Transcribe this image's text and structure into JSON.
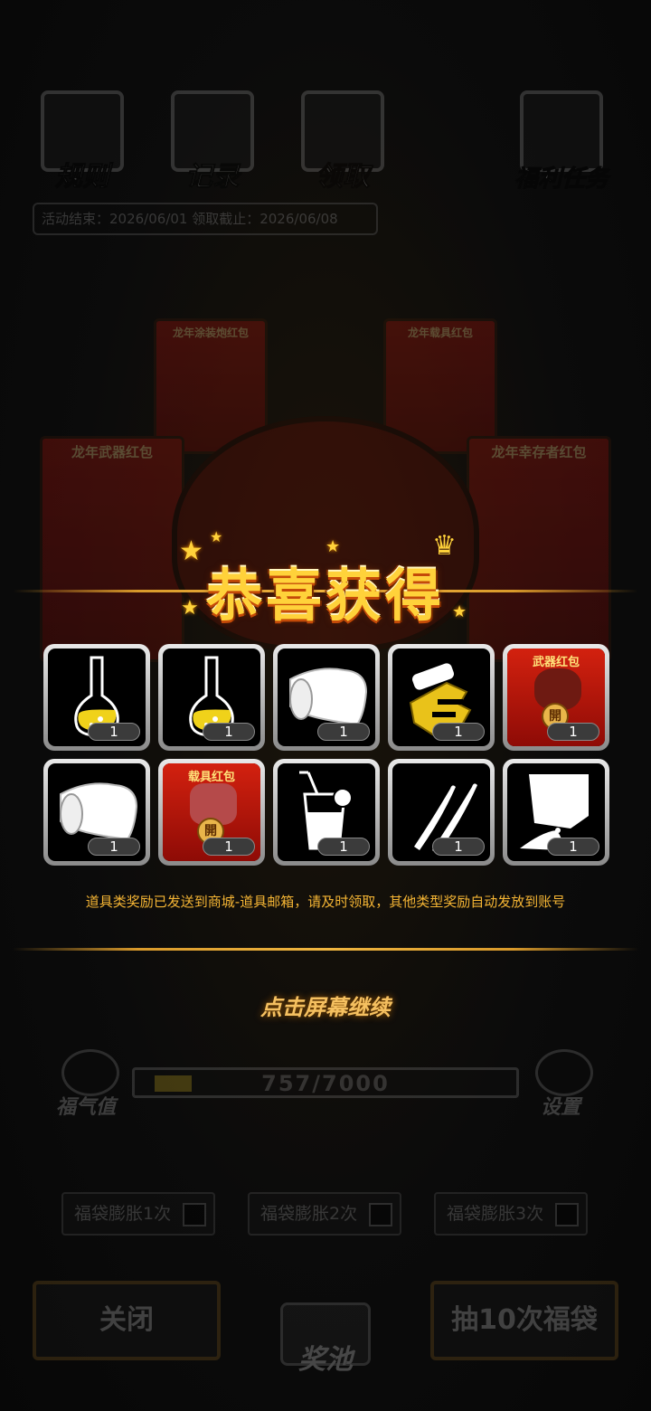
{
  "top_bar": {
    "rules_label": "规则",
    "records_label": "记录",
    "claim_label": "领取",
    "tasks_label": "福利任务",
    "event_info": "活动结束：2026/06/01  领取截止：2026/06/08"
  },
  "background_cards": {
    "top_left": "龙年涂装炮红包",
    "top_right": "龙年载具红包",
    "mid_left": "龙年武器红包",
    "mid_right": "龙年幸存者红包",
    "seal": "開"
  },
  "reward_popup": {
    "title": "恭喜获得",
    "items": [
      {
        "icon": "yellow-flask-icon",
        "qty": "1"
      },
      {
        "icon": "yellow-flask-icon",
        "qty": "1"
      },
      {
        "icon": "white-scroll-icon",
        "qty": "1"
      },
      {
        "icon": "gold-mechanism-icon",
        "qty": "1"
      },
      {
        "icon": "weapon-red-packet-icon",
        "qty": "1",
        "label": "武器红包",
        "seal": "開"
      },
      {
        "icon": "white-scroll-icon",
        "qty": "1"
      },
      {
        "icon": "vehicle-red-packet-icon",
        "qty": "1",
        "label": "载具红包",
        "seal": "開"
      },
      {
        "icon": "drink-glass-icon",
        "qty": "1"
      },
      {
        "icon": "claw-scratch-icon",
        "qty": "1"
      },
      {
        "icon": "white-cloth-icon",
        "qty": "1"
      }
    ],
    "notice": "道具类奖励已发送到商城-道具邮箱，请及时领取，其他类型奖励自动发放到账号",
    "continue_hint": "点击屏幕继续"
  },
  "progress": {
    "label": "福气值",
    "value_text": "757/7000",
    "fraction": 0.108,
    "settings_label": "设置"
  },
  "options": {
    "opt1": "福袋膨胀1次",
    "opt2": "福袋膨胀2次",
    "opt3": "福袋膨胀3次"
  },
  "bottom": {
    "close_label": "关闭",
    "pool_label": "奖池",
    "draw_label": "抽10次福袋"
  },
  "colors": {
    "accent_gold": "#ffd23a",
    "notice_orange": "#f5b534",
    "band_gold": "#d99a2b"
  }
}
